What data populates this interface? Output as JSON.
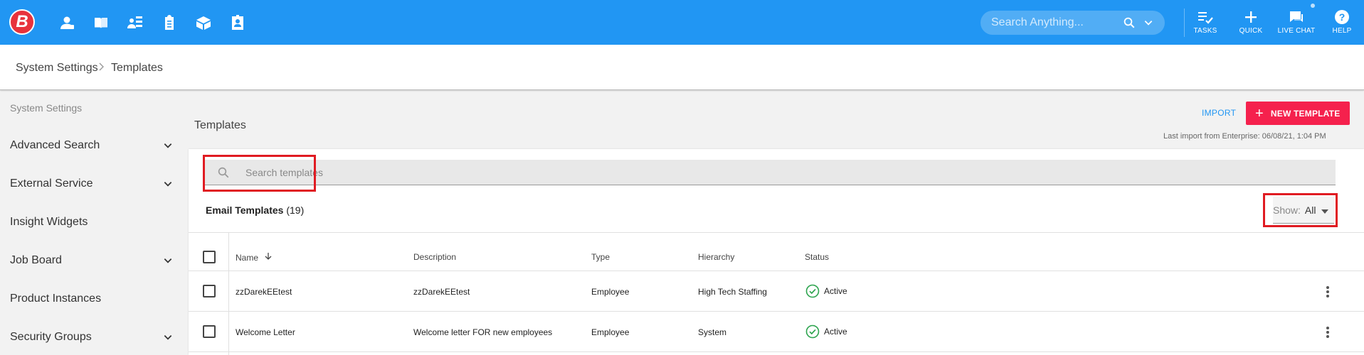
{
  "topbar": {
    "logo_letter": "B",
    "search_placeholder": "Search Anything...",
    "actions": [
      {
        "label": "TASKS",
        "icon": "tasks-icon"
      },
      {
        "label": "QUICK",
        "icon": "plus-icon"
      },
      {
        "label": "LIVE CHAT",
        "icon": "chat-icon"
      },
      {
        "label": "HELP",
        "icon": "help-icon"
      }
    ],
    "nav_icons": [
      "person-icon",
      "book-icon",
      "org-chart-icon",
      "clipboard-icon",
      "package-icon",
      "id-badge-icon"
    ]
  },
  "breadcrumb": {
    "parent": "System Settings",
    "current": "Templates"
  },
  "sidebar": {
    "heading": "System Settings",
    "items": [
      {
        "label": "Advanced Search",
        "has_children": true
      },
      {
        "label": "External Service",
        "has_children": true
      },
      {
        "label": "Insight Widgets",
        "has_children": false
      },
      {
        "label": "Job Board",
        "has_children": true
      },
      {
        "label": "Product Instances",
        "has_children": false
      },
      {
        "label": "Security Groups",
        "has_children": true
      }
    ]
  },
  "main": {
    "title": "Templates",
    "import_label": "IMPORT",
    "new_template_label": "NEW TEMPLATE",
    "last_import": "Last import from Enterprise: 06/08/21, 1:04 PM",
    "search_placeholder": "Search templates",
    "section_title": "Email Templates",
    "section_count": "(19)",
    "show_label": "Show:",
    "show_value": "All",
    "columns": [
      "Name",
      "Description",
      "Type",
      "Hierarchy",
      "Status"
    ],
    "rows": [
      {
        "name": "zzDarekEEtest",
        "description": "zzDarekEEtest",
        "type": "Employee",
        "hierarchy": "High Tech Staffing",
        "status": "Active"
      },
      {
        "name": "Welcome Letter",
        "description": "Welcome letter FOR new employees",
        "type": "Employee",
        "hierarchy": "System",
        "status": "Active"
      }
    ]
  },
  "colors": {
    "topbar": "#2196f3",
    "accent_red": "#f5214d",
    "highlight_box": "#e01b22",
    "status_green": "#2ea44f"
  }
}
